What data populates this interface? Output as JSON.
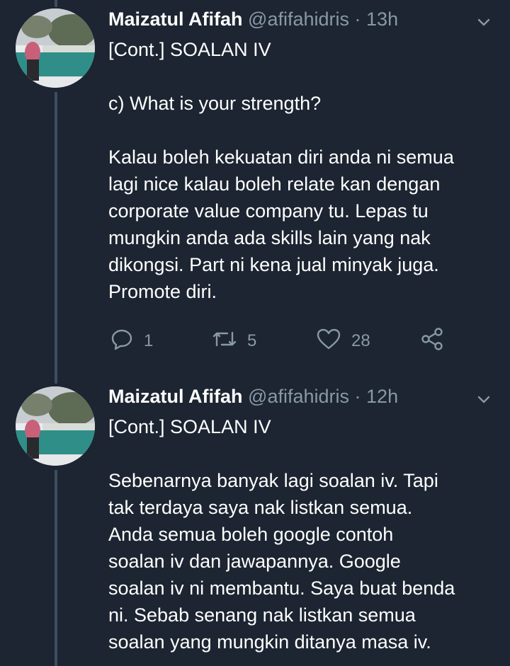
{
  "tweets": [
    {
      "author_name": "Maizatul Afifah",
      "handle": "@afifahidris",
      "separator": "·",
      "time": "13h",
      "paragraphs": [
        [
          "[Cont.] SOALAN IV"
        ],
        [
          "c) What is your strength?"
        ],
        [
          "Kalau boleh kekuatan diri anda ni semua",
          "lagi nice kalau boleh relate kan dengan",
          "corporate value company tu. Lepas tu",
          "mungkin anda ada skills lain yang nak",
          "dikongsi. Part ni kena jual minyak juga.",
          "Promote diri."
        ]
      ],
      "actions": {
        "reply_count": "1",
        "retweet_count": "5",
        "like_count": "28"
      }
    },
    {
      "author_name": "Maizatul Afifah",
      "handle": "@afifahidris",
      "separator": "·",
      "time": "12h",
      "paragraphs": [
        [
          "[Cont.] SOALAN IV"
        ],
        [
          "Sebenarnya banyak lagi soalan iv. Tapi",
          "tak terdaya saya nak listkan semua.",
          "Anda semua boleh google contoh",
          "soalan iv dan jawapannya. Google",
          "soalan iv ni membantu. Saya buat benda",
          "ni. Sebab senang nak listkan semua",
          "soalan yang mungkin ditanya masa iv."
        ]
      ]
    }
  ],
  "icons": {
    "reply": "reply-icon",
    "retweet": "retweet-icon",
    "like": "heart-icon",
    "share": "share-icon",
    "menu": "chevron-down-icon"
  },
  "colors": {
    "background": "#1c2531",
    "text": "#ffffff",
    "muted": "#8899a6",
    "thread_line": "#3d4d60"
  }
}
